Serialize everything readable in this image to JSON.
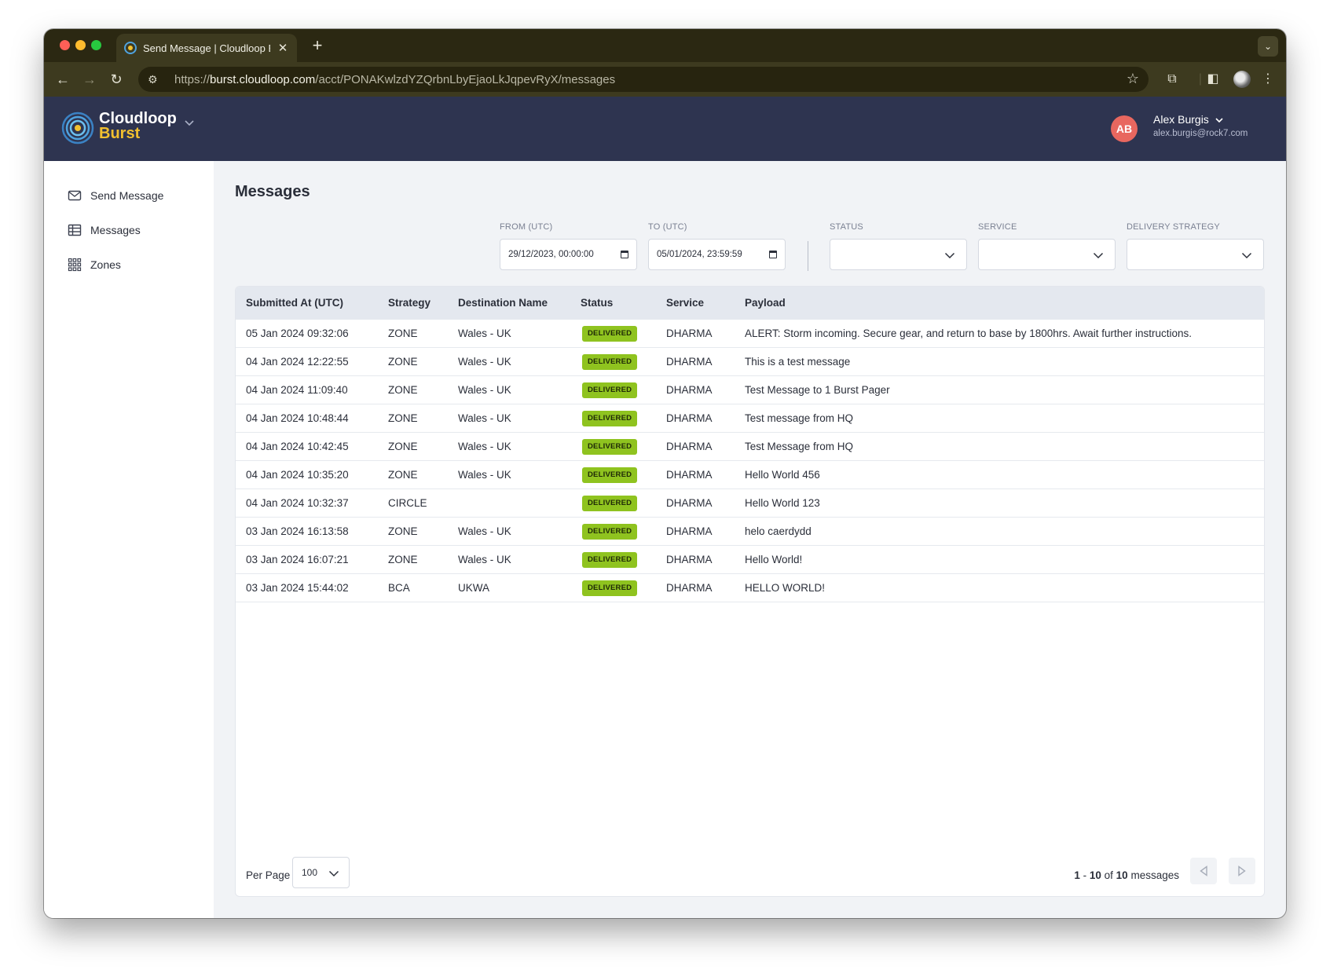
{
  "browser": {
    "tab_title": "Send Message | Cloudloop Burst",
    "url_scheme": "https://",
    "url_host": "burst.cloudloop.com",
    "url_path": "/acct/PONAKwlzdYZQrbnLbyEjaoLkJqpevRyX/messages"
  },
  "header": {
    "logo_line1": "Cloudloop",
    "logo_line2": "Burst",
    "user_initials": "AB",
    "user_name": "Alex Burgis",
    "user_email": "alex.burgis@rock7.com"
  },
  "sidebar": {
    "items": [
      {
        "label": "Send Message",
        "icon": "envelope-icon"
      },
      {
        "label": "Messages",
        "icon": "table-icon"
      },
      {
        "label": "Zones",
        "icon": "grid-icon"
      }
    ]
  },
  "page": {
    "title": "Messages"
  },
  "filters": {
    "from_label": "FROM (UTC)",
    "from_value": "29/12/2023, 00:00:00",
    "to_label": "TO (UTC)",
    "to_value": "05/01/2024, 23:59:59",
    "status_label": "STATUS",
    "status_value": "",
    "service_label": "SERVICE",
    "service_value": "",
    "strategy_label": "DELIVERY STRATEGY",
    "strategy_value": ""
  },
  "table": {
    "columns": [
      "Submitted At (UTC)",
      "Strategy",
      "Destination Name",
      "Status",
      "Service",
      "Payload"
    ],
    "rows": [
      {
        "submitted": "05 Jan 2024 09:32:06",
        "strategy": "ZONE",
        "destination": "Wales - UK",
        "status": "DELIVERED",
        "service": "DHARMA",
        "payload": "ALERT: Storm incoming. Secure gear, and return to base by 1800hrs. Await further instructions."
      },
      {
        "submitted": "04 Jan 2024 12:22:55",
        "strategy": "ZONE",
        "destination": "Wales - UK",
        "status": "DELIVERED",
        "service": "DHARMA",
        "payload": "This is a test message"
      },
      {
        "submitted": "04 Jan 2024 11:09:40",
        "strategy": "ZONE",
        "destination": "Wales - UK",
        "status": "DELIVERED",
        "service": "DHARMA",
        "payload": "Test Message to 1 Burst Pager"
      },
      {
        "submitted": "04 Jan 2024 10:48:44",
        "strategy": "ZONE",
        "destination": "Wales - UK",
        "status": "DELIVERED",
        "service": "DHARMA",
        "payload": "Test message from HQ"
      },
      {
        "submitted": "04 Jan 2024 10:42:45",
        "strategy": "ZONE",
        "destination": "Wales - UK",
        "status": "DELIVERED",
        "service": "DHARMA",
        "payload": "Test Message from HQ"
      },
      {
        "submitted": "04 Jan 2024 10:35:20",
        "strategy": "ZONE",
        "destination": "Wales - UK",
        "status": "DELIVERED",
        "service": "DHARMA",
        "payload": "Hello World 456"
      },
      {
        "submitted": "04 Jan 2024 10:32:37",
        "strategy": "CIRCLE",
        "destination": "",
        "status": "DELIVERED",
        "service": "DHARMA",
        "payload": "Hello World 123"
      },
      {
        "submitted": "03 Jan 2024 16:13:58",
        "strategy": "ZONE",
        "destination": "Wales - UK",
        "status": "DELIVERED",
        "service": "DHARMA",
        "payload": "helo caerdydd"
      },
      {
        "submitted": "03 Jan 2024 16:07:21",
        "strategy": "ZONE",
        "destination": "Wales - UK",
        "status": "DELIVERED",
        "service": "DHARMA",
        "payload": "Hello World!"
      },
      {
        "submitted": "03 Jan 2024 15:44:02",
        "strategy": "BCA",
        "destination": "UKWA",
        "status": "DELIVERED",
        "service": "DHARMA",
        "payload": "HELLO WORLD!"
      }
    ]
  },
  "pagination": {
    "per_page_label": "Per Page",
    "per_page_value": "100",
    "range_start": "1",
    "range_end": "10",
    "total": "10",
    "suffix": "messages"
  },
  "colors": {
    "header_bg": "#2e3450",
    "accent_yellow": "#f2c02f",
    "status_delivered": "#8fc31f",
    "avatar": "#e8675f"
  }
}
